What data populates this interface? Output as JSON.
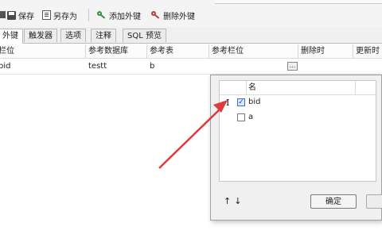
{
  "toolbar": {
    "save_label": "保存",
    "save_as_label": "另存为",
    "add_fk_label": "添加外键",
    "delete_fk_label": "删除外键"
  },
  "tabs": [
    {
      "label": "外键",
      "active": true
    },
    {
      "label": "触发器",
      "active": false
    },
    {
      "label": "选项",
      "active": false
    },
    {
      "label": "注释",
      "active": false
    },
    {
      "label": "SQL 预览",
      "active": false
    }
  ],
  "grid": {
    "columns": [
      "栏位",
      "参考数据库",
      "参考表",
      "参考栏位",
      "删除时",
      "更新时"
    ],
    "rows": [
      {
        "field": "bid",
        "ref_db": "testt",
        "ref_table": "b",
        "ref_field": "",
        "on_delete": "",
        "on_update": ""
      }
    ],
    "ellipsis_label": "..."
  },
  "popup": {
    "header": "名",
    "items": [
      {
        "label": "bid",
        "checked": true
      },
      {
        "label": "a",
        "checked": false
      }
    ],
    "checkmark": "✓",
    "cursor_glyph": "I",
    "move_up": "↑",
    "move_down": "↓",
    "ok_label": "确定"
  },
  "colors": {
    "arrow": "#e0393b",
    "selection": "#3b6fcf"
  }
}
